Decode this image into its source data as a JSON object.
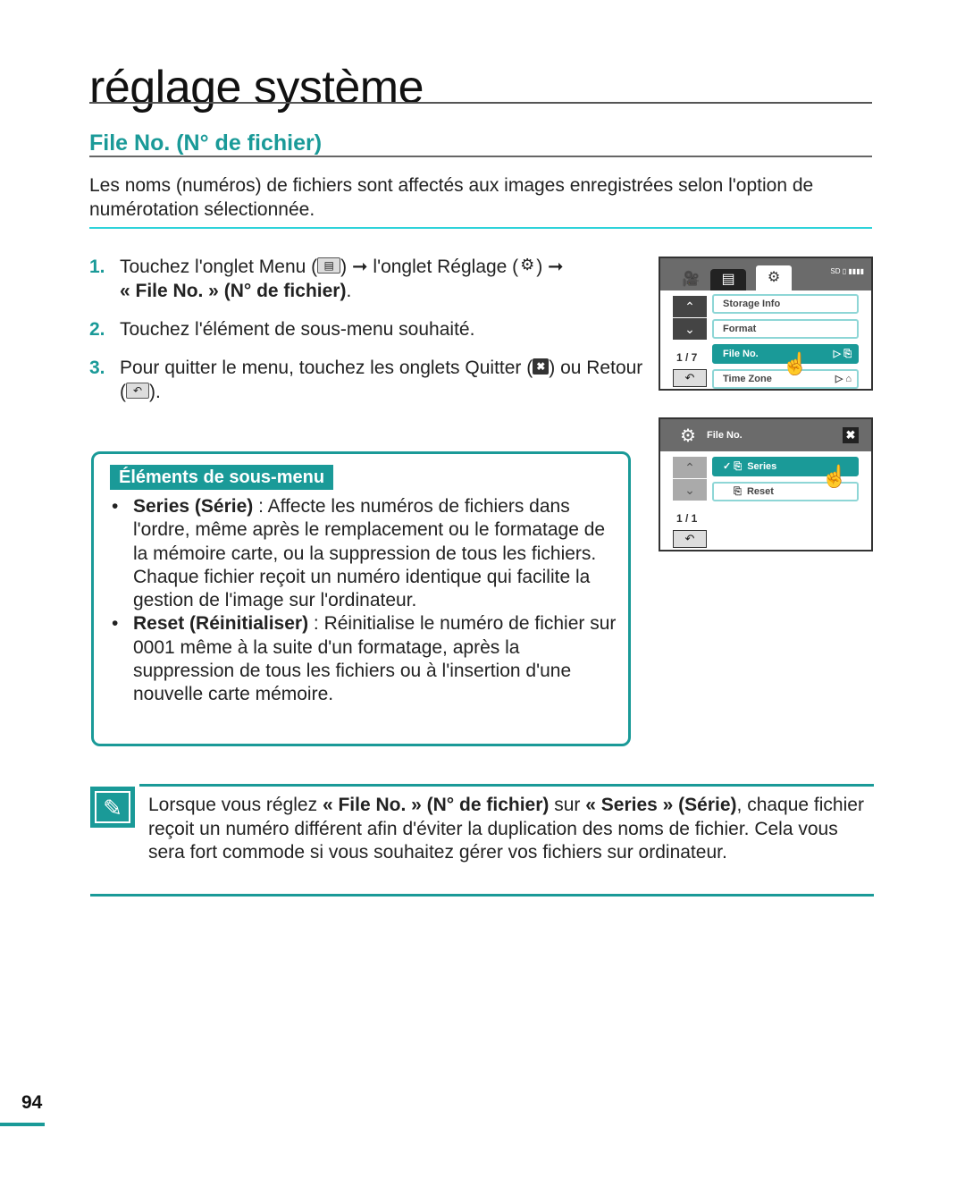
{
  "page": {
    "title": "réglage système",
    "number": "94"
  },
  "section": {
    "title": "File No. (N° de fichier)",
    "intro": "Les noms (numéros) de fichiers sont affectés aux images enregistrées selon l'option de numérotation sélectionnée."
  },
  "steps": [
    {
      "num": "1.",
      "parts": [
        "Touchez l'onglet Menu (",
        ") ➞ l'onglet Réglage (",
        ") ➞"
      ],
      "bold": "« File No. » (N° de fichier)",
      "end": ".",
      "icons": [
        "menu-icon",
        "gear-icon"
      ]
    },
    {
      "num": "2.",
      "text": "Touchez l'élément de sous-menu souhaité."
    },
    {
      "num": "3.",
      "parts": [
        "Pour quitter le menu, touchez les onglets Quitter (",
        ") ou Retour (",
        ")."
      ],
      "icons": [
        "close-icon",
        "back-icon"
      ]
    }
  ],
  "icons": {
    "menu": "▤",
    "gear": "⚙",
    "close": "✖",
    "back": "↶",
    "camera": "🎥",
    "up": "⌃",
    "down": "⌄",
    "play": "▷",
    "hand": "☝",
    "check": "✓",
    "note": "✎"
  },
  "screen1": {
    "status": "SD ▯ ▮▮▮▮",
    "pager": "1 / 7",
    "items": [
      {
        "label": "Storage Info",
        "selected": false,
        "right": ""
      },
      {
        "label": "Format",
        "selected": false,
        "right": ""
      },
      {
        "label": "File No.",
        "selected": true,
        "right": "▷ ⎘"
      },
      {
        "label": "Time Zone",
        "selected": false,
        "right": "▷ ⌂"
      }
    ]
  },
  "screen2": {
    "header": "File No.",
    "pager": "1 / 1",
    "items": [
      {
        "label": "Series",
        "selected": true,
        "prefix": "✓ ⎘"
      },
      {
        "label": "Reset",
        "selected": false,
        "prefix": "⎘"
      }
    ]
  },
  "submenu": {
    "label": "Éléments de sous-menu",
    "items": [
      {
        "term": "Series (Série)",
        "desc": " : Affecte les numéros de fichiers dans l'ordre, même après le remplacement ou le formatage de la mémoire carte, ou la suppression de tous les fichiers. Chaque fichier reçoit un numéro identique qui facilite la gestion de l'image sur l'ordinateur."
      },
      {
        "term": "Reset (Réinitialiser)",
        "desc": " : Réinitialise le numéro de fichier sur 0001 même à la suite d'un formatage, après la suppression de tous les fichiers ou à l'insertion d'une nouvelle carte mémoire."
      }
    ]
  },
  "note": {
    "p1": "Lorsque vous réglez ",
    "b1": "« File No. » (N° de fichier)",
    "p2": " sur ",
    "b2": "« Series » (Série)",
    "p3": ", chaque fichier reçoit un numéro différent afin d'éviter la duplication des noms de fichier. Cela vous sera fort commode si vous souhaitez gérer vos fichiers sur ordinateur."
  },
  "colors": {
    "accent": "#1a9a98",
    "intro_rule": "#2ed3da"
  }
}
